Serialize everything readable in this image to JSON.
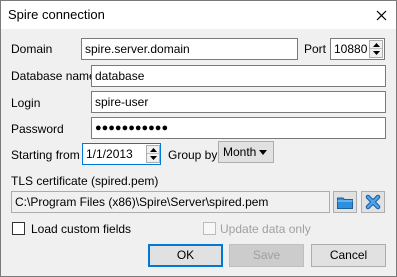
{
  "window": {
    "title": "Spire connection"
  },
  "form": {
    "domain_label": "Domain",
    "domain_value": "spire.server.domain",
    "port_label": "Port",
    "port_value": "10880",
    "database_label": "Database name",
    "database_value": "database",
    "login_label": "Login",
    "login_value": "spire-user",
    "password_label": "Password",
    "password_value": "●●●●●●●●●●●",
    "starting_label": "Starting from",
    "starting_value": "1/1/2013",
    "groupby_label": "Group by",
    "groupby_value": "Month",
    "tls_label": "TLS certificate (spired.pem)",
    "tls_value": "C:\\Program Files (x86)\\Spire\\Server\\spired.pem",
    "load_custom_label": "Load custom fields",
    "update_only_label": "Update data only"
  },
  "buttons": {
    "ok": "OK",
    "save": "Save",
    "cancel": "Cancel"
  },
  "icons": {
    "browse": "folder-icon",
    "clear": "clear-x-icon",
    "close": "close-icon"
  },
  "colors": {
    "accent": "#0078d7",
    "folder": "#2f8fdf",
    "clear": "#2a7fd4"
  }
}
